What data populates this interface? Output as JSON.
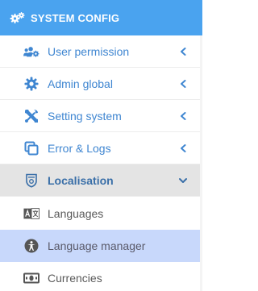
{
  "header": {
    "title": "SYSTEM CONFIG",
    "icon": "cogs-icon",
    "bg_color": "#4aa3ef"
  },
  "menu": [
    {
      "label": "User permission",
      "icon": "users-cog-icon",
      "state": "collapsed"
    },
    {
      "label": "Admin global",
      "icon": "gear-icon",
      "state": "collapsed"
    },
    {
      "label": "Setting system",
      "icon": "tools-icon",
      "state": "collapsed"
    },
    {
      "label": "Error & Logs",
      "icon": "copy-icon",
      "state": "collapsed"
    },
    {
      "label": "Localisation",
      "icon": "shield-icon",
      "state": "expanded"
    }
  ],
  "submenu": [
    {
      "label": "Languages",
      "icon": "language-icon"
    },
    {
      "label": "Language manager",
      "icon": "universal-access-icon",
      "selected": true
    },
    {
      "label": "Currencies",
      "icon": "money-bill-icon"
    }
  ],
  "colors": {
    "menu_label": "#3f86d1",
    "active_bg": "#e4e4e4",
    "selected_bg": "#c8d8fb"
  }
}
